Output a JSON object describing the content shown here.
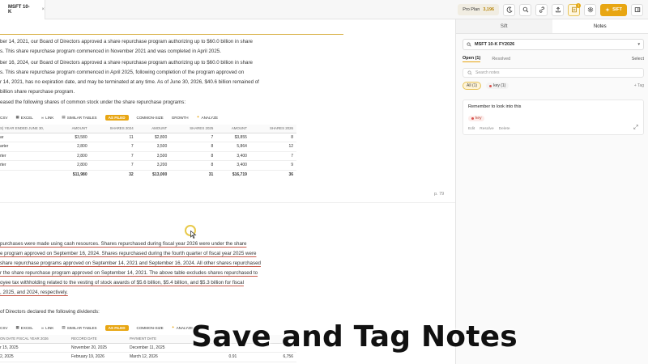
{
  "topbar": {
    "doc_tab": "MSFT 10-K",
    "doc_tab_close": "×",
    "plan_label": "Pro Plan",
    "credits": "3,196",
    "notes_badge": "1",
    "sift_label": "SIFT"
  },
  "doc": {
    "p1": [
      "ber 14, 2021, our Board of Directors approved a share repurchase program authorizing up to $60.0 billion in share",
      "s. This share repurchase program commenced in November 2021 and was completed in April 2025."
    ],
    "p2": [
      "ber 16, 2024, our Board of Directors approved a share repurchase program authorizing up to $60.0 billion in share",
      "s. This share repurchase program commenced in April 2025, following completion of the program approved on",
      "r 14, 2021, has no expiration date, and may be terminated at any time. As of June 30, 2026, $40.6 billion remained of",
      "billion share repurchase program."
    ],
    "p3": "eased the following shares of common stock under the share repurchase programs:",
    "toolbar1": [
      "CSV",
      "EXCEL",
      "LINK",
      "SIMILAR TABLES",
      "AS FILED",
      "COMMON-SIZE",
      "GROWTH",
      "ANALYZE"
    ],
    "table1": {
      "headers": [
        "S) YEAR ENDED JUNE 30,",
        "AMOUNT",
        "SHARES 2024",
        "AMOUNT",
        "SHARES 2025",
        "AMOUNT",
        "SHARES 2026"
      ],
      "rows": [
        [
          "ar",
          "$3,580",
          "11",
          "$2,800",
          "7",
          "$3,855",
          "8"
        ],
        [
          "arter",
          "2,800",
          "7",
          "3,500",
          "8",
          "5,864",
          "12"
        ],
        [
          "rter",
          "2,800",
          "7",
          "3,500",
          "8",
          "3,400",
          "7"
        ],
        [
          "rter",
          "2,800",
          "7",
          "3,200",
          "8",
          "3,400",
          "9"
        ]
      ],
      "total": [
        "",
        "$11,980",
        "32",
        "$13,000",
        "31",
        "$16,719",
        "36"
      ]
    },
    "page_number": "p. 79",
    "p4": [
      "purchases were made using cash resources. Shares repurchased during fiscal year 2026 were under the share",
      "e program approved on September 16, 2024. Shares repurchased during the fourth quarter of fiscal year 2025 were",
      "share repurchase programs approved on September 14, 2021 and September 16, 2024. All other shares repurchased",
      "r the share repurchase program approved on September 14, 2021. The above table excludes shares repurchased to",
      "oyee tax withholding related to the vesting of stock awards of $5.6 billion, $5.4 billion, and $5.3 billion for fiscal",
      ", 2025, and 2024, respectively."
    ],
    "p5": "of Directors declared the following dividends:",
    "toolbar2": [
      "CSV",
      "EXCEL",
      "LINK",
      "SIMILAR TABLES",
      "AS FILED",
      "COMMON-SIZE",
      "ANALYZE"
    ],
    "table2": {
      "headers": [
        "ON DATE FISCAL YEAR 2026",
        "RECORD DATE",
        "PAYMENT DATE",
        "",
        ""
      ],
      "rows": [
        [
          "r 15, 2025",
          "November 20, 2025",
          "December 11, 2025",
          "",
          ""
        ],
        [
          "2, 2025",
          "February 19, 2026",
          "March 12, 2026",
          "0.91",
          "6,756"
        ]
      ]
    },
    "caption": "Save and Tag Notes"
  },
  "panel": {
    "tabs": [
      "Sift",
      "Notes"
    ],
    "doc_select": "MSFT 10-K FY2026",
    "open_tab": "Open (1)",
    "resolved_tab": "Resolved",
    "select_label": "Select",
    "search_placeholder": "Search notes",
    "filter_all": "All (1)",
    "filter_key": "key (1)",
    "add_tag": "+ Tag",
    "note_text": "Remember to look into this",
    "note_tag": "key",
    "note_actions": [
      "Edit",
      "Resolve",
      "Delete"
    ]
  }
}
